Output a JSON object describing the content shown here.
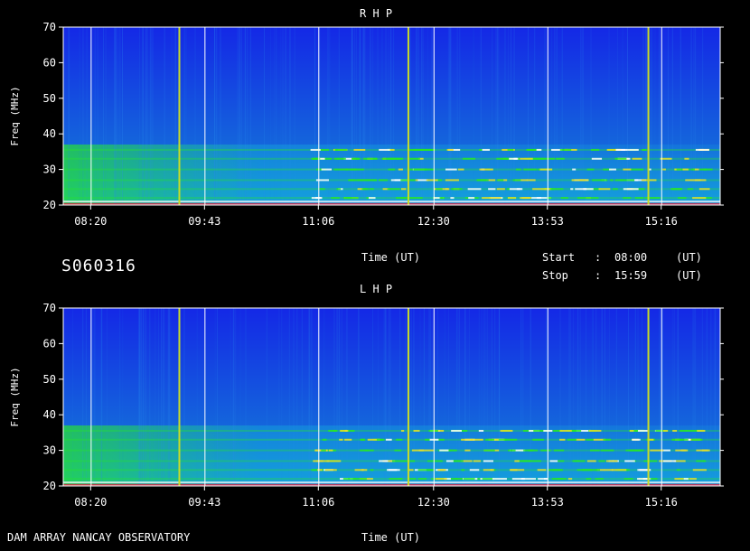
{
  "header": {
    "date_code": "S060316",
    "time_label": "Time (UT)",
    "start_label": "Start",
    "stop_label": "Stop",
    "sep": ":",
    "start_value": "08:00",
    "stop_value": "15:59",
    "unit": "(UT)"
  },
  "footer": {
    "observatory": "DAM ARRAY   NANCAY OBSERVATORY",
    "time_label": "Time (UT)"
  },
  "chart_data": [
    {
      "type": "heatmap",
      "title": "R H P",
      "xlabel": "Time (UT)",
      "ylabel": "Freq (MHz)",
      "ylim": [
        20,
        70
      ],
      "yticks": [
        20,
        30,
        40,
        50,
        60,
        70
      ],
      "xlim_minutes": [
        480,
        959
      ],
      "xticks": [
        "08:20",
        "09:43",
        "11:06",
        "12:30",
        "13:53",
        "15:16"
      ],
      "xticks_minutes": [
        500,
        583,
        666,
        750,
        833,
        916
      ],
      "white_lines_min": [
        500,
        583,
        666,
        750,
        833,
        916
      ],
      "yellow_lines_min": [
        564,
        731,
        906
      ],
      "emission_bands_mhz": [
        22,
        24.5,
        27,
        30,
        33,
        35.5
      ]
    },
    {
      "type": "heatmap",
      "title": "L H P",
      "xlabel": "Time (UT)",
      "ylabel": "Freq (MHz)",
      "ylim": [
        20,
        70
      ],
      "yticks": [
        20,
        30,
        40,
        50,
        60,
        70
      ],
      "xlim_minutes": [
        480,
        959
      ],
      "xticks": [
        "08:20",
        "09:43",
        "11:06",
        "12:30",
        "13:53",
        "15:16"
      ],
      "xticks_minutes": [
        500,
        583,
        666,
        750,
        833,
        916
      ],
      "white_lines_min": [
        500,
        583,
        666,
        750,
        833,
        916
      ],
      "yellow_lines_min": [
        564,
        731,
        906
      ],
      "emission_bands_mhz": [
        22,
        24.5,
        27,
        30,
        33,
        35.5
      ]
    }
  ],
  "colors": {
    "background": "#000000",
    "spectrum_low": "#1428e6",
    "spectrum_mid": "#14a0dc",
    "spectrum_high": "#28e628",
    "marker_white": "#ffffff",
    "marker_yellow": "#c8dc28"
  }
}
